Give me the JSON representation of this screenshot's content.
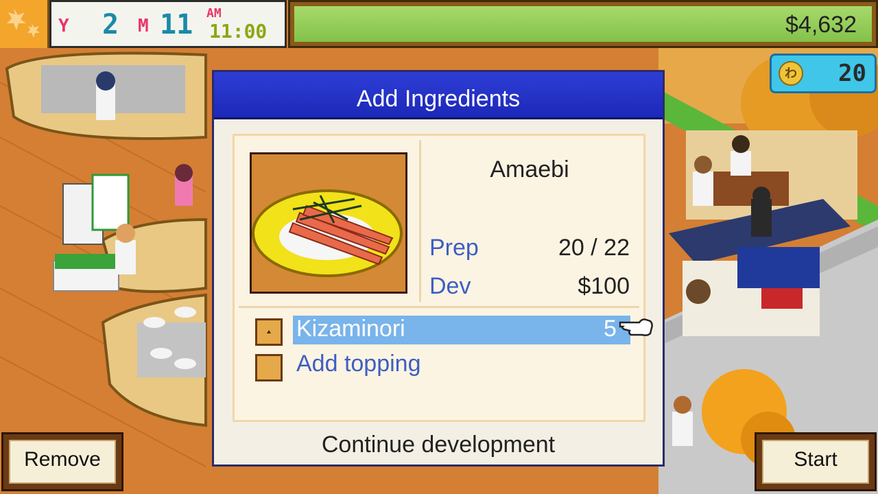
{
  "hud": {
    "year_label": "Y",
    "year": "2",
    "month_label": "M",
    "month": "11",
    "ampm": "AM",
    "time": "11:00",
    "money": "$4,632",
    "coins": "20",
    "coin_glyph": "わ"
  },
  "dialog": {
    "title": "Add Ingredients",
    "dish_name": "Amaebi",
    "prep_label": "Prep",
    "prep_value": "20  / 22",
    "dev_label": "Dev",
    "dev_value": "$100",
    "ingredients": [
      {
        "name": "Kizaminori",
        "qty": "5"
      }
    ],
    "add_topping_label": "Add topping",
    "continue_label": "Continue development"
  },
  "buttons": {
    "remove": "Remove",
    "start": "Start"
  },
  "colors": {
    "header_blue": "#1c28b8",
    "highlight": "#79b4ea",
    "label_blue": "#3d5ec4",
    "money_green": "#83c24a"
  }
}
